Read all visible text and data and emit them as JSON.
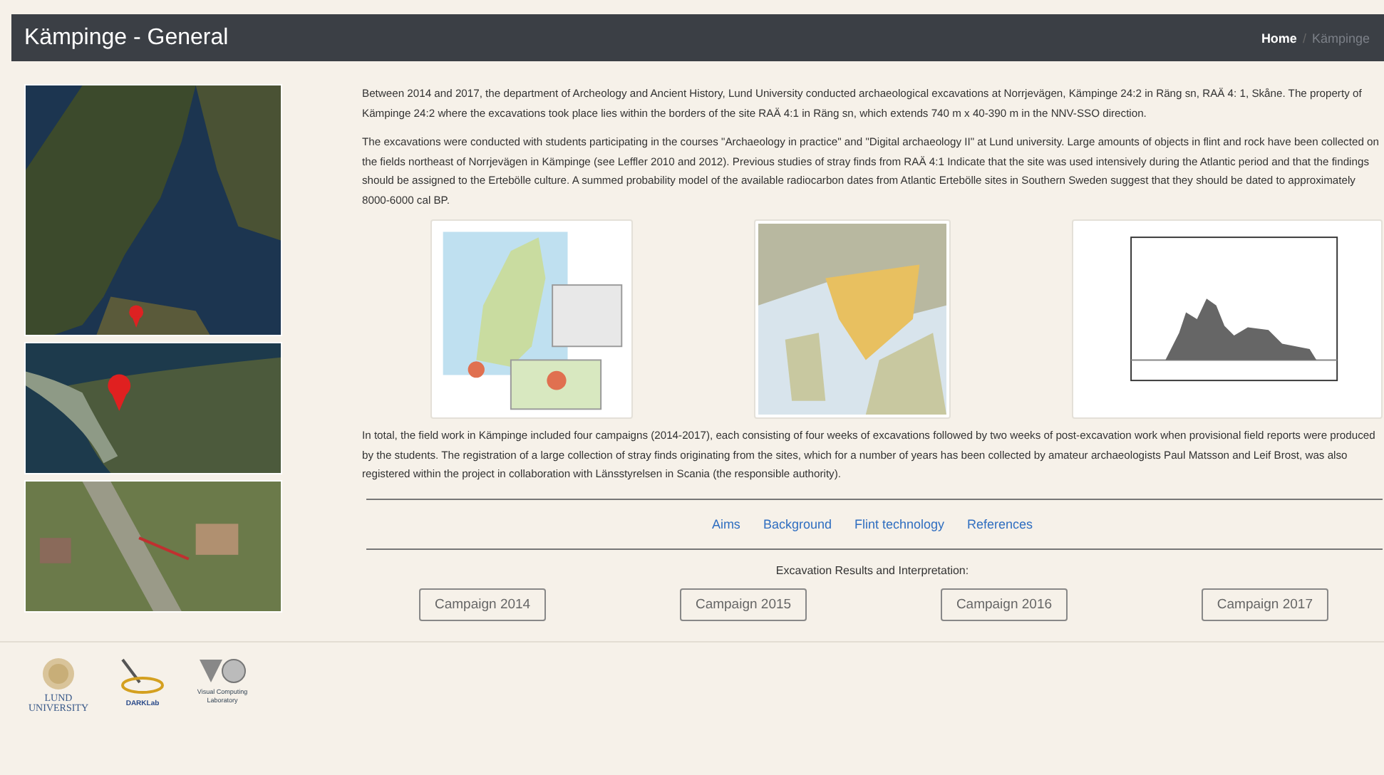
{
  "header": {
    "title": "Kämpinge - General",
    "breadcrumb_separator": "/",
    "breadcrumb": [
      {
        "label": "Home",
        "current": false
      },
      {
        "label": "Kämpinge",
        "current": true
      }
    ]
  },
  "side_images": [
    {
      "kind": "satellite-overview"
    },
    {
      "kind": "satellite-coast"
    },
    {
      "kind": "aerial-site"
    }
  ],
  "paragraphs_top": [
    "Between 2014 and 2017, the department of Archeology and Ancient History, Lund University conducted archaeological excavations at Norrjevägen, Kämpinge 24:2 in Räng sn, RAÄ 4: 1, Skåne. The property of Kämpinge 24:2 where the excavations took place lies within the borders of the site RAÄ 4:1 in Räng sn, which extends 740 m x 40-390 m in the NNV-SSO direction.",
    "The excavations were conducted with students participating in the courses \"Archaeology in practice\" and \"Digital archaeology II\" at Lund university. Large amounts of objects in flint and rock have been collected on the fields northeast of Norrjevägen in Kämpinge (see Leffler 2010 and 2012). Previous studies of stray finds from RAÄ 4:1 Indicate that the site was used intensively during the Atlantic period and that the findings should be assigned to the Ertebölle culture. A summed probability model of the available radiocarbon dates from Atlantic Ertebölle sites in Southern Sweden suggest that they should be dated to approximately 8000-6000 cal BP."
  ],
  "figures": [
    {
      "kind": "location-map"
    },
    {
      "kind": "region-map"
    },
    {
      "kind": "density-plot"
    }
  ],
  "paragraph_bottom": "In total, the field work in Kämpinge included four campaigns (2014-2017), each consisting of four weeks of excavations followed by two weeks of post-excavation work when provisional field reports were produced by the students. The registration of a large collection of stray finds originating from the sites, which for a number of years has been collected by amateur archaeologists Paul Matsson and Leif Brost, was also registered within the project in collaboration with Länsstyrelsen in Scania (the responsible authority).",
  "links": [
    "Aims",
    "Background",
    "Flint technology",
    "References"
  ],
  "results_heading": "Excavation Results and Interpretation:",
  "campaign_buttons": [
    "Campaign 2014",
    "Campaign 2015",
    "Campaign 2016",
    "Campaign 2017"
  ],
  "footer_logos": [
    {
      "kind": "lund",
      "lines": [
        "LUND",
        "UNIVERSITY"
      ]
    },
    {
      "kind": "darklab",
      "lines": [
        "DARKLab"
      ]
    },
    {
      "kind": "vcl",
      "lines": [
        "Visual Computing",
        "Laboratory"
      ]
    }
  ]
}
